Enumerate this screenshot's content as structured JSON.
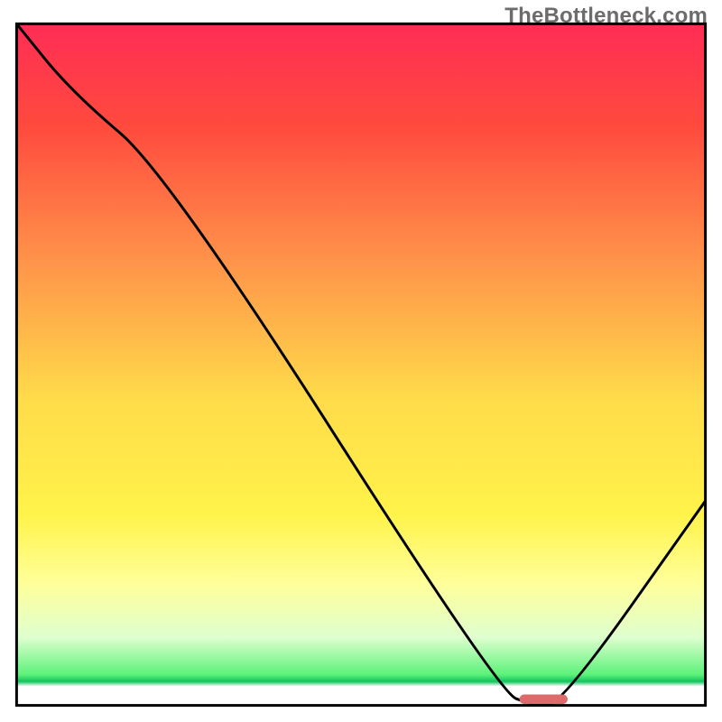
{
  "watermark": "TheBottleneck.com",
  "chart_data": {
    "type": "line",
    "title": "",
    "xlabel": "",
    "ylabel": "",
    "xlim": [
      0,
      100
    ],
    "ylim": [
      0,
      100
    ],
    "background_gradient": {
      "stops": [
        {
          "pct": 0,
          "color": "#ff2d55"
        },
        {
          "pct": 15,
          "color": "#ff4a3e"
        },
        {
          "pct": 35,
          "color": "#ff944a"
        },
        {
          "pct": 55,
          "color": "#ffdb4a"
        },
        {
          "pct": 72,
          "color": "#fff34a"
        },
        {
          "pct": 82,
          "color": "#ffff99"
        },
        {
          "pct": 90,
          "color": "#dfffcf"
        },
        {
          "pct": 95.5,
          "color": "#5cf27a"
        },
        {
          "pct": 96.5,
          "color": "#12c35e"
        },
        {
          "pct": 97.2,
          "color": "#ffffff"
        },
        {
          "pct": 100,
          "color": "#ffffff"
        }
      ]
    },
    "series": [
      {
        "name": "bottleneck-curve",
        "color": "#000000",
        "x": [
          0,
          8,
          22,
          70,
          75,
          79,
          100
        ],
        "values": [
          100,
          90,
          78,
          2,
          0,
          0,
          30
        ]
      }
    ],
    "marker": {
      "name": "target-range",
      "color": "#de6b6b",
      "x_start": 73,
      "x_end": 80,
      "y": 0.2,
      "height": 1.4,
      "rx": 0.9
    },
    "frame_color": "#000000",
    "frame_inset_pct": {
      "left": 2.3,
      "right": 2.3,
      "top": 3.3,
      "bottom": 2.3
    }
  }
}
